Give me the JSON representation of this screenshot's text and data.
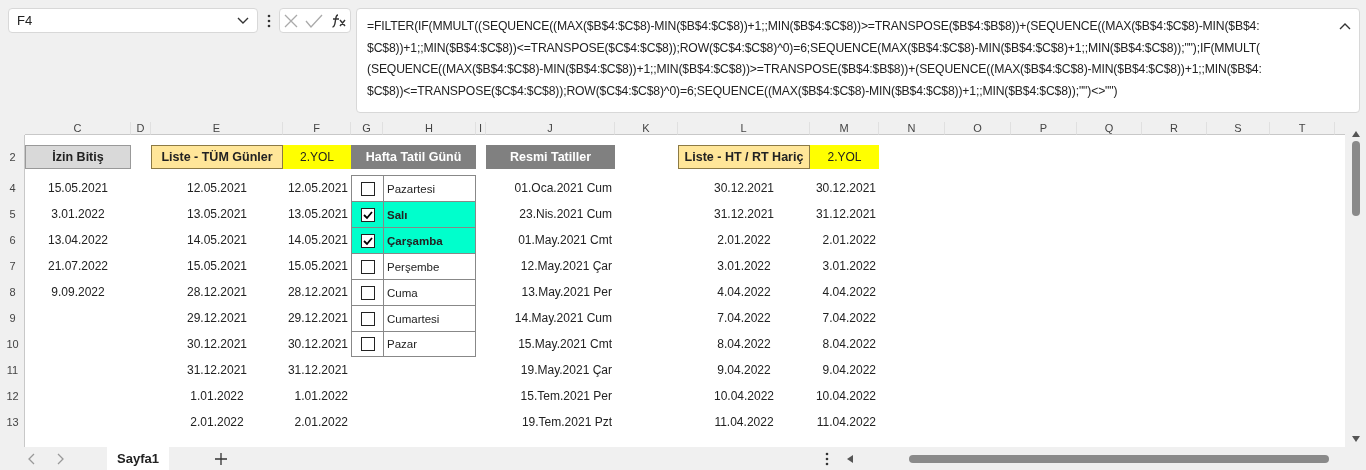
{
  "name_box": {
    "value": "F4"
  },
  "formula_lines": [
    "=FILTER(IF(MMULT((SEQUENCE((MAX($B$4:$C$8)-MIN($B$4:$C$8))+1;;MIN($B$4:$C$8))>=TRANSPOSE($B$4:$B$8))+(SEQUENCE((MAX($B$4:$C$8)-MIN($B$4:",
    "$C$8))+1;;MIN($B$4:$C$8))<=TRANSPOSE($C$4:$C$8));ROW($C$4:$C$8)^0)=6;SEQUENCE(MAX($B$4:$C$8)-MIN($B$4:$C$8)+1;;MIN($B$4:$C$8));\"\");IF(MMULT(",
    "(SEQUENCE((MAX($B$4:$C$8)-MIN($B$4:$C$8))+1;;MIN($B$4:$C$8))>=TRANSPOSE($B$4:$B$8))+(SEQUENCE((MAX($B$4:$C$8)-MIN($B$4:$C$8))+1;;MIN($B$4:",
    "$C$8))<=TRANSPOSE($C$4:$C$8));ROW($C$4:$C$8)^0)=6;SEQUENCE((MAX($B$4:$C$8)-MIN($B$4:$C$8))+1;;MIN($B$4:$C$8));\"\")<>\"\")"
  ],
  "columns": [
    "C",
    "D",
    "E",
    "F",
    "G",
    "H",
    "I",
    "J",
    "K",
    "L",
    "M",
    "N",
    "O",
    "P",
    "Q",
    "R",
    "S",
    "T"
  ],
  "row_numbers": [
    "2",
    "4",
    "5",
    "6",
    "7",
    "8",
    "9",
    "10",
    "11",
    "12",
    "13"
  ],
  "izin_bitis": {
    "header": "İzin Bitiş",
    "values": [
      "15.05.2021",
      "3.01.2022",
      "13.04.2022",
      "21.07.2022",
      "9.09.2022"
    ]
  },
  "tum_gunler": {
    "header": "Liste - TÜM Günler",
    "values": [
      "12.05.2021",
      "13.05.2021",
      "14.05.2021",
      "15.05.2021",
      "28.12.2021",
      "29.12.2021",
      "30.12.2021",
      "31.12.2021",
      "1.01.2022",
      "2.01.2022"
    ]
  },
  "yol_a": {
    "header": "2.YOL",
    "values": [
      "12.05.2021",
      "13.05.2021",
      "14.05.2021",
      "15.05.2021",
      "28.12.2021",
      "29.12.2021",
      "30.12.2021",
      "31.12.2021",
      "1.01.2022",
      "2.01.2022"
    ]
  },
  "hafta_tatil": {
    "header": "Hafta Tatil Günü",
    "days": [
      {
        "label": "Pazartesi",
        "checked": false
      },
      {
        "label": "Salı",
        "checked": true
      },
      {
        "label": "Çarşamba",
        "checked": true
      },
      {
        "label": "Perşembe",
        "checked": false
      },
      {
        "label": "Cuma",
        "checked": false
      },
      {
        "label": "Cumartesi",
        "checked": false
      },
      {
        "label": "Pazar",
        "checked": false
      }
    ]
  },
  "resmi_tatiller": {
    "header": "Resmi Tatiller",
    "values": [
      "01.Oca.2021 Cum",
      "23.Nis.2021 Cum",
      "01.May.2021 Cmt",
      "12.May.2021 Çar",
      "13.May.2021 Per",
      "14.May.2021 Cum",
      "15.May.2021 Cmt",
      "19.May.2021 Çar",
      "15.Tem.2021 Per",
      "19.Tem.2021 Pzt"
    ]
  },
  "ht_rt_haric": {
    "header": "Liste - HT / RT Hariç",
    "values": [
      "30.12.2021",
      "31.12.2021",
      "2.01.2022",
      "3.01.2022",
      "4.04.2022",
      "7.04.2022",
      "8.04.2022",
      "9.04.2022",
      "10.04.2022",
      "11.04.2022"
    ]
  },
  "yol_b": {
    "header": "2.YOL",
    "values": [
      "30.12.2021",
      "31.12.2021",
      "2.01.2022",
      "3.01.2022",
      "4.04.2022",
      "7.04.2022",
      "8.04.2022",
      "9.04.2022",
      "10.04.2022",
      "11.04.2022"
    ]
  },
  "sheet_tabs": [
    {
      "label": "Sayfa1",
      "selected": true
    }
  ]
}
